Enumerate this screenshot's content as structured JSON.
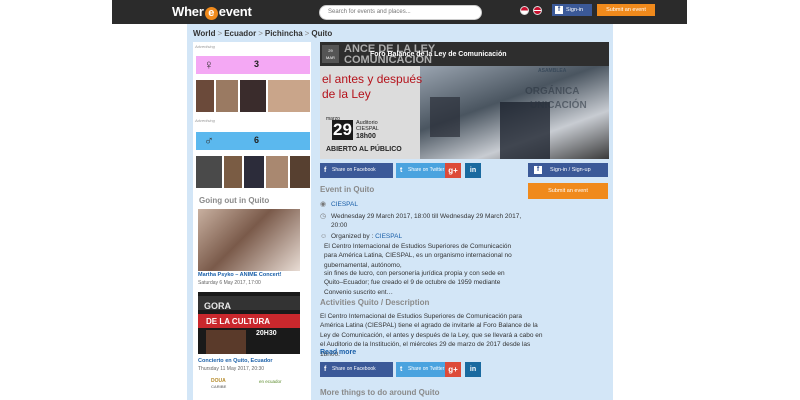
{
  "header": {
    "logo_left": "Wher",
    "logo_e": "e",
    "logo_right": "event",
    "search_placeholder": "Search for events and places...",
    "signin_label": "Sign-in",
    "submit_label": "Submit an event"
  },
  "breadcrumb": [
    "World",
    "Ecuador",
    "Pichincha",
    "Quito"
  ],
  "sidebar": {
    "advertising": "Advertising",
    "female_symbol": "♀",
    "female_count": "3",
    "male_symbol": "♂",
    "male_count": "6",
    "heading": "Going out in Quito",
    "events": [
      {
        "title": "Martha Psyko – ANIME Concert!",
        "date": "Saturday 6 May 2017, 17:00"
      },
      {
        "title": "Concierto en Quito, Ecuador",
        "date": "Thursday 11 May 2017, 20:30"
      }
    ],
    "poster_text_1": "GORA",
    "poster_text_2": "DE LA CULTURA",
    "poster_text_3": "20H30",
    "footer_logo_1": "DOUA",
    "footer_logo_2": "CARIBE",
    "footer_logo_3": "en ecuador"
  },
  "banner": {
    "big_text": "ANCE DE LA LEY",
    "big_text_2": "COMUNICACIÓN",
    "badge_1": "29",
    "badge_2": "MAR",
    "title": "Foro Balance de la Ley de Comunicación",
    "antes_1": "el antes y después",
    "antes_2": "de la Ley",
    "marzo": "marzo",
    "day": "29",
    "aud_1": "Auditorio",
    "aud_2": "CIESPAL",
    "hora": "18h00",
    "abierto": "ABIERTO AL PÚBLICO",
    "sign_1": "ORGÁNICA",
    "sign_2": "UNICACIÓN",
    "sign_3": "ASAMBLEA"
  },
  "share": {
    "facebook": "Share on Facebook",
    "twitter": "Share on Twitter",
    "gplus": "g+",
    "linkedin": "in"
  },
  "actions": {
    "signin": "Sign-in / Sign-up",
    "submit": "Submit an event"
  },
  "event": {
    "section_title": "Event in Quito",
    "venue": "CIESPAL",
    "datetime": "Wednesday 29 March 2017, 18:00 till Wednesday 29 March 2017, 20:00",
    "organized_label": "Organized by :",
    "organizer": "CIESPAL",
    "org_desc_1": "El Centro Internacional de Estudios Superiores de Comunicación para América Latina, CIESPAL, es un organismo internacional no gubernamental, autónomo,",
    "org_desc_2": "sin fines de lucro, con personería jurídica propia y con sede en Quito–Ecuador; fue creado el 9 de octubre de 1959 mediante Convenio suscrito ent…",
    "activities_title": "Activities Quito / Description",
    "description": "El Centro Internacional de Estudios Superiores de Comunicación para América Latina (CIESPAL) tiene el agrado de invitarle al Foro Balance de la Ley de Comunicación, el antes y después de la Ley, que se llevará a cabo en el Auditorio de la Institución, el miércoles 29 de marzo de 2017 desde las 18h00.",
    "read_more": "Read more",
    "more_title": "More things to do around Quito"
  },
  "colors": {
    "facebook": "#3b5998",
    "twitter": "#4aa3df",
    "gplus": "#dd4b39",
    "linkedin": "#1a6aa0",
    "orange": "#f08a1c",
    "female_box": "#f4a8f4",
    "male_box": "#5bb8ee",
    "page_blue": "#d3e6f7"
  }
}
